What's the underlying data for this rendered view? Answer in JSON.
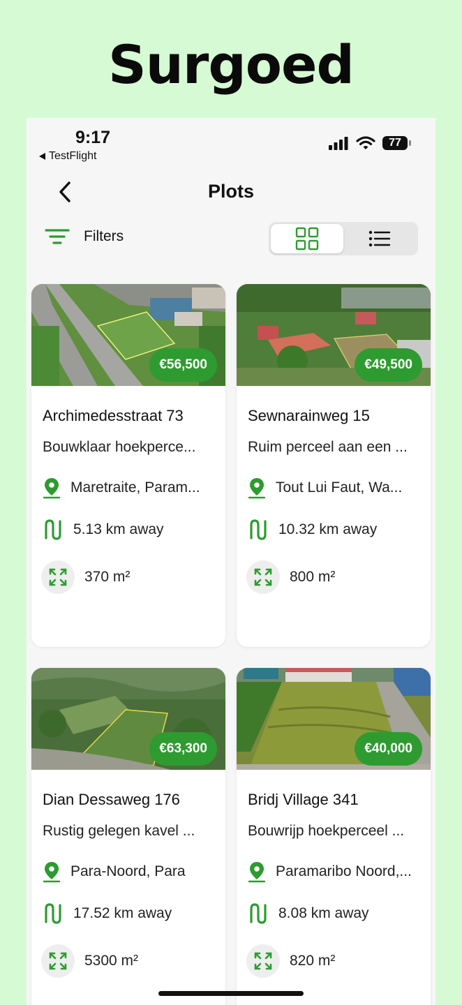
{
  "brand": "Surgoed",
  "status": {
    "time": "9:17",
    "back_app": "TestFlight",
    "battery": "77"
  },
  "nav": {
    "title": "Plots"
  },
  "filters": {
    "label": "Filters"
  },
  "view_toggle": {
    "selected": "grid"
  },
  "plots": [
    {
      "price": "€56,500",
      "title": "Archimedesstraat 73",
      "description": "Bouwklaar hoekperce...",
      "location": "Maretraite, Param...",
      "distance": "5.13 km away",
      "area": "370 m²"
    },
    {
      "price": "€49,500",
      "title": "Sewnarainweg 15",
      "description": "Ruim perceel aan een ...",
      "location": "Tout Lui Faut, Wa...",
      "distance": "10.32 km away",
      "area": "800 m²"
    },
    {
      "price": "€63,300",
      "title": "Dian Dessaweg 176",
      "description": "Rustig gelegen kavel ...",
      "location": "Para-Noord, Para",
      "distance": "17.52 km away",
      "area": "5300 m²"
    },
    {
      "price": "€40,000",
      "title": "Bridj Village 341",
      "description": "Bouwrijp hoekperceel ...",
      "location": "Paramaribo Noord,...",
      "distance": "8.08 km away",
      "area": "820 m²"
    }
  ],
  "colors": {
    "accent": "#2e9b31",
    "page_background": "#d6fbd4"
  }
}
